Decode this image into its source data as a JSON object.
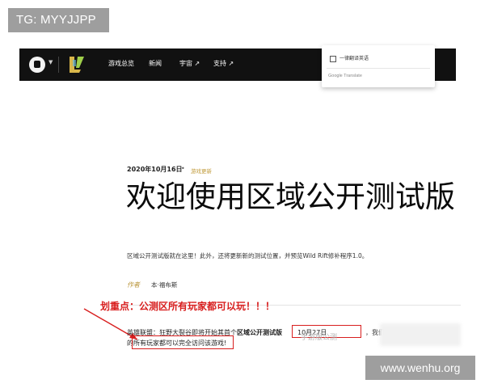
{
  "tags": {
    "top_left": "TG: MYYJJPP",
    "bottom_right": "www.wenhu.org"
  },
  "nav": {
    "items": [
      {
        "label": "游戏总览"
      },
      {
        "label": "新闻"
      },
      {
        "label": "宇宙 ↗"
      },
      {
        "label": "支持 ↗"
      }
    ]
  },
  "translate_popup": {
    "option_label": "一律翻译英语",
    "footer": "Google Translate"
  },
  "article": {
    "date": "2020年10月16日",
    "separator": "•",
    "tag": "游戏更新",
    "headline": "欢迎使用区域公开测试版",
    "subtitle": "区域公开测试版就在这里！此外，还将更新新的测试位置，并预览Wild Rift修补程序1.0。",
    "author_label": "作者",
    "author_name": "本·福布斯"
  },
  "annotation": {
    "text": "划重点：公测区所有玩家都可以玩！！！"
  },
  "body": {
    "line1_start": "英雄联盟：狂野大裂谷即将开始其首个",
    "line1_bold": "区域公开测试版",
    "line1_date": "10月27日",
    "line1_tail": "，我们所在",
    "line2_start": "的",
    "line2_highlight": "所有玩家都可以完全访问该游戏!",
    "watermark": "手游版公测"
  },
  "colors": {
    "annotation_red": "#d81e1e",
    "navbar_bg": "#111111",
    "accent_gold": "#c09a3a",
    "tag_gray": "#9e9e9e"
  }
}
